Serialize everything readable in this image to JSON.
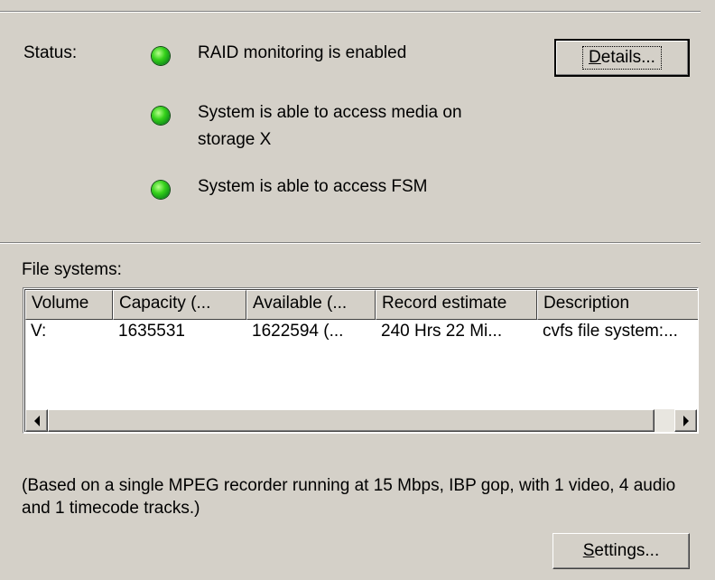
{
  "status": {
    "label": "Status:",
    "led_color": "#22c41a",
    "items": [
      {
        "text": "RAID monitoring is enabled"
      },
      {
        "text_line1": "System is able to access media on",
        "text_line2": "storage X"
      },
      {
        "text": "System is able to access FSM"
      }
    ],
    "details_button": {
      "underline": "D",
      "rest": "etails..."
    }
  },
  "file_systems": {
    "label": "File systems:",
    "columns": [
      "Volume",
      "Capacity (...",
      "Available (...",
      "Record estimate",
      "Description"
    ],
    "rows": [
      [
        "V:",
        "1635531",
        "1622594 (...",
        "240 Hrs 22 Mi...",
        "cvfs file system:..."
      ]
    ]
  },
  "note": "(Based on a single MPEG recorder running at 15 Mbps, IBP gop, with 1 video, 4 audio and 1 timecode tracks.)",
  "settings_button": {
    "underline": "S",
    "rest": "ettings..."
  }
}
